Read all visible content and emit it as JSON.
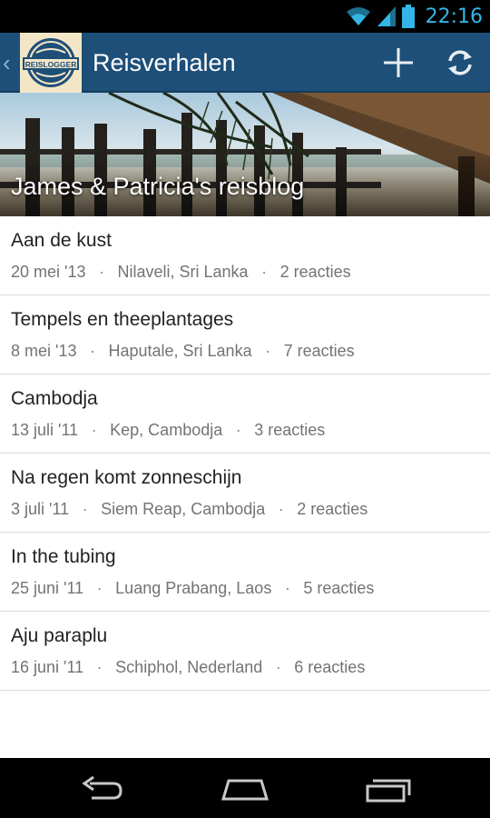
{
  "status_bar": {
    "time": "22:16",
    "icons": [
      "wifi-icon",
      "signal-icon",
      "battery-icon"
    ],
    "accent": "#33b5e5"
  },
  "action_bar": {
    "title": "Reisverhalen",
    "logo_text": "REISLOGGER",
    "actions": [
      "add-icon",
      "refresh-icon"
    ],
    "color": "#1d4f78"
  },
  "blog": {
    "title": "James & Patricia's reisblog"
  },
  "posts": [
    {
      "title": "Aan de kust",
      "date": "20 mei '13",
      "location": "Nilaveli, Sri Lanka",
      "reactions": "2 reacties"
    },
    {
      "title": "Tempels en theeplantages",
      "date": "8 mei '13",
      "location": "Haputale, Sri Lanka",
      "reactions": "7 reacties"
    },
    {
      "title": "Cambodja",
      "date": "13 juli '11",
      "location": "Kep, Cambodja",
      "reactions": "3 reacties"
    },
    {
      "title": "Na regen komt zonneschijn",
      "date": "3 juli '11",
      "location": "Siem Reap, Cambodja",
      "reactions": "2 reacties"
    },
    {
      "title": "In the tubing",
      "date": "25 juni '11",
      "location": "Luang Prabang, Laos",
      "reactions": "5 reacties"
    },
    {
      "title": "Aju paraplu",
      "date": "16 juni '11",
      "location": "Schiphol, Nederland",
      "reactions": "6 reacties"
    }
  ],
  "separator": "·",
  "nav_bar": {
    "buttons": [
      "back-icon",
      "home-icon",
      "recent-apps-icon"
    ]
  }
}
